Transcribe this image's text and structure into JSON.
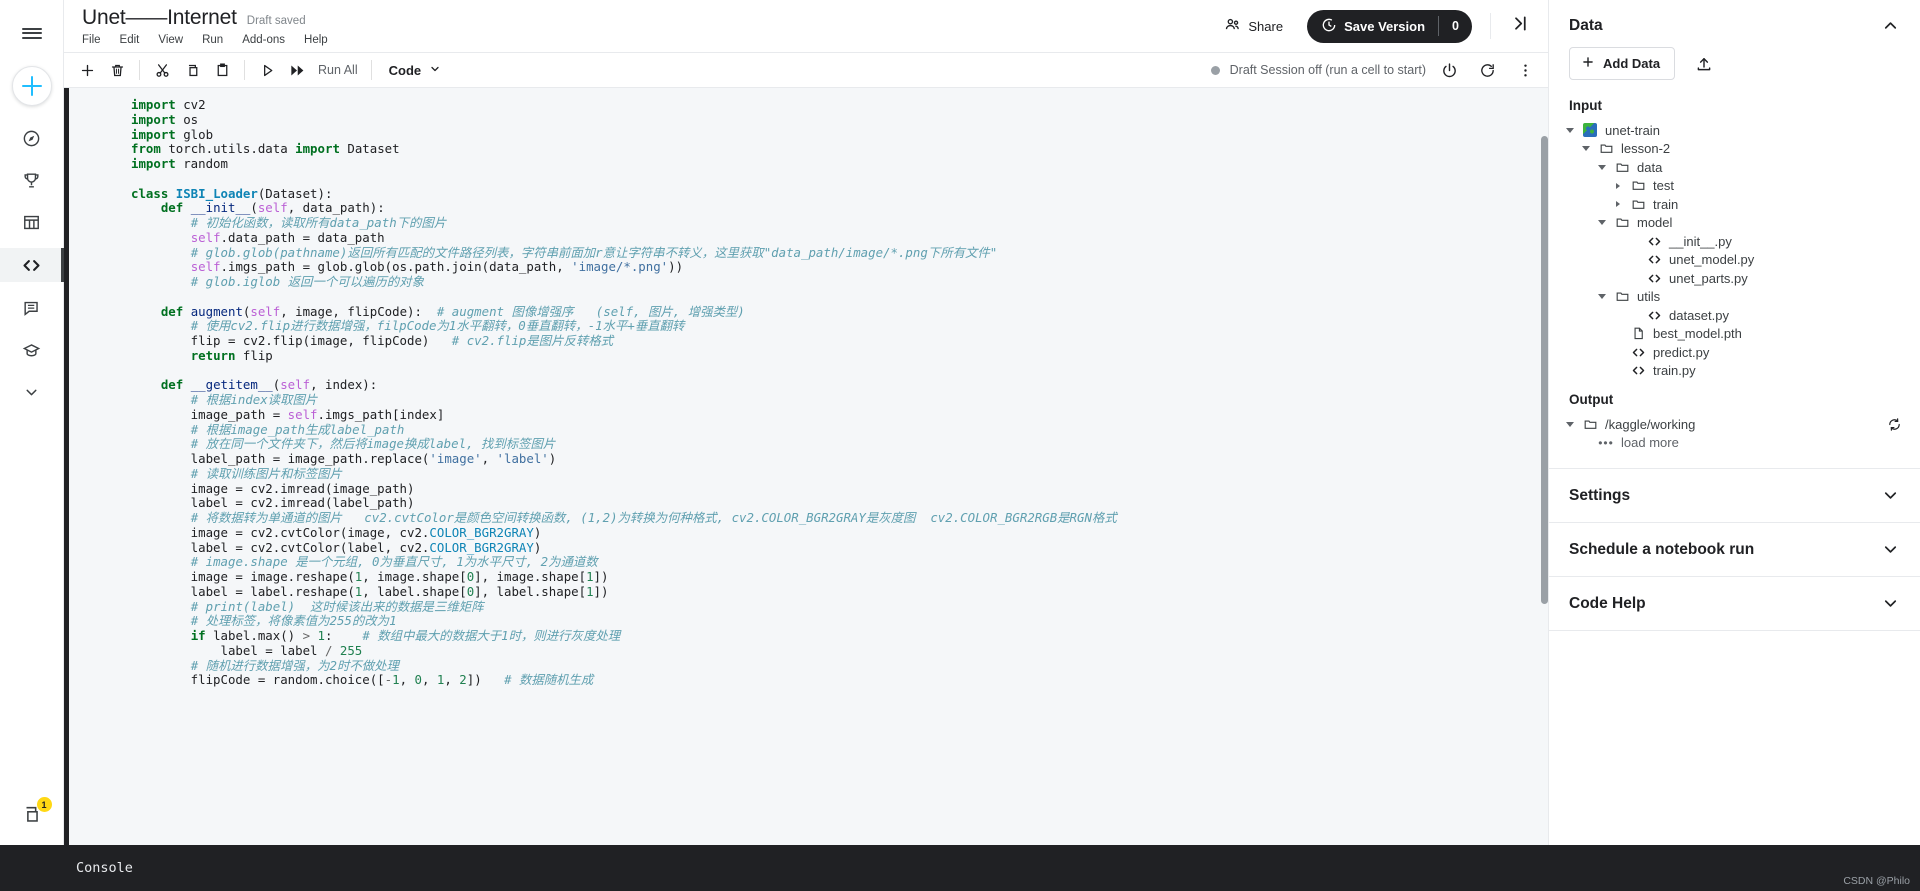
{
  "rail": {
    "hamburger": "menu-icon",
    "create_label": "create-new",
    "items": [
      {
        "name": "home-compass-icon"
      },
      {
        "name": "competitions-trophy-icon"
      },
      {
        "name": "datasets-table-icon"
      },
      {
        "name": "code-icon"
      },
      {
        "name": "discussions-icon"
      },
      {
        "name": "learn-graduation-icon"
      },
      {
        "name": "more-chevron-down-icon"
      }
    ],
    "bottom_badge": "1"
  },
  "header": {
    "title": "Unet——Internet",
    "draft_status": "Draft saved",
    "menu": [
      "File",
      "Edit",
      "View",
      "Run",
      "Add-ons",
      "Help"
    ],
    "share_label": "Share",
    "save_version_label": "Save Version",
    "save_version_count": "0"
  },
  "toolbar": {
    "icons": [
      "add-cell-icon",
      "delete-cell-icon",
      "cut-icon",
      "copy-icon",
      "paste-icon",
      "run-icon",
      "run-all-icon"
    ],
    "run_all_label": "Run All",
    "cell_type": "Code",
    "session_status": "Draft Session off (run a cell to start)",
    "power_icon": "power-icon",
    "restart_icon": "restart-icon",
    "more_icon": "more-vertical-icon"
  },
  "code": {
    "lines": [
      [
        [
          "kn",
          "import "
        ],
        [
          "p",
          "cv2"
        ]
      ],
      [
        [
          "kn",
          "import "
        ],
        [
          "p",
          "os"
        ]
      ],
      [
        [
          "kn",
          "import "
        ],
        [
          "p",
          "glob"
        ]
      ],
      [
        [
          "kn",
          "from "
        ],
        [
          "p",
          "torch.utils.data "
        ],
        [
          "kn",
          "import "
        ],
        [
          "p",
          "Dataset"
        ]
      ],
      [
        [
          "kn",
          "import "
        ],
        [
          "p",
          "random"
        ]
      ],
      [],
      [
        [
          "k",
          "class "
        ],
        [
          "cls",
          "ISBI_Loader"
        ],
        [
          "p",
          "(Dataset):"
        ]
      ],
      [
        [
          "p",
          "    "
        ],
        [
          "k",
          "def "
        ],
        [
          "fn",
          "__init__"
        ],
        [
          "p",
          "("
        ],
        [
          "se",
          "self"
        ],
        [
          "p",
          ", data_path):"
        ]
      ],
      [
        [
          "p",
          "        "
        ],
        [
          "cm",
          "# 初始化函数，读取所有data_path下的图片"
        ]
      ],
      [
        [
          "p",
          "        "
        ],
        [
          "se",
          "self"
        ],
        [
          "p",
          ".data_path = data_path"
        ]
      ],
      [
        [
          "p",
          "        "
        ],
        [
          "cm",
          "# glob.glob(pathname)返回所有匹配的文件路径列表，字符串前面加r意让字符串不转义，这里获取\"data_path/image/*.png下所有文件\""
        ]
      ],
      [
        [
          "p",
          "        "
        ],
        [
          "se",
          "self"
        ],
        [
          "p",
          ".imgs_path = glob.glob(os.path.join(data_path, "
        ],
        [
          "st",
          "'image/*.png'"
        ],
        [
          "p",
          "))"
        ]
      ],
      [
        [
          "p",
          "        "
        ],
        [
          "cm",
          "# glob.iglob 返回一个可以遍历的对象"
        ]
      ],
      [],
      [
        [
          "p",
          "    "
        ],
        [
          "k",
          "def "
        ],
        [
          "fn",
          "augment"
        ],
        [
          "p",
          "("
        ],
        [
          "se",
          "self"
        ],
        [
          "p",
          ", image, flipCode):  "
        ],
        [
          "cm",
          "# augment 图像增强序   (self, 图片, 增强类型)"
        ]
      ],
      [
        [
          "p",
          "        "
        ],
        [
          "cm",
          "# 使用cv2.flip进行数据增强，filpCode为1水平翻转，0垂直翻转，-1水平+垂直翻转"
        ]
      ],
      [
        [
          "p",
          "        flip = cv2.flip(image, flipCode)   "
        ],
        [
          "cm",
          "# cv2.flip是图片反转格式"
        ]
      ],
      [
        [
          "p",
          "        "
        ],
        [
          "k",
          "return "
        ],
        [
          "p",
          "flip"
        ]
      ],
      [],
      [
        [
          "p",
          "    "
        ],
        [
          "k",
          "def "
        ],
        [
          "fn",
          "__getitem__"
        ],
        [
          "p",
          "("
        ],
        [
          "se",
          "self"
        ],
        [
          "p",
          ", index):"
        ]
      ],
      [
        [
          "p",
          "        "
        ],
        [
          "cm",
          "# 根据index读取图片"
        ]
      ],
      [
        [
          "p",
          "        image_path = "
        ],
        [
          "se",
          "self"
        ],
        [
          "p",
          ".imgs_path[index]"
        ]
      ],
      [
        [
          "p",
          "        "
        ],
        [
          "cm",
          "# 根据image_path生成label_path"
        ]
      ],
      [
        [
          "p",
          "        "
        ],
        [
          "cm",
          "# 放在同一个文件夹下，然后将image换成label, 找到标签图片"
        ]
      ],
      [
        [
          "p",
          "        label_path = image_path.replace("
        ],
        [
          "st",
          "'image'"
        ],
        [
          "p",
          ", "
        ],
        [
          "st",
          "'label'"
        ],
        [
          "p",
          ")"
        ]
      ],
      [
        [
          "p",
          "        "
        ],
        [
          "cm",
          "# 读取训练图片和标签图片"
        ]
      ],
      [
        [
          "p",
          "        image = cv2.imread(image_path)"
        ]
      ],
      [
        [
          "p",
          "        label = cv2.imread(label_path)"
        ]
      ],
      [
        [
          "p",
          "        "
        ],
        [
          "cm",
          "# 将数据转为单通道的图片   cv2.cvtColor是颜色空间转换函数, (1,2)为转换为何种格式, cv2.COLOR_BGR2GRAY是灰度图  cv2.COLOR_BGR2RGB是RGN格式"
        ]
      ],
      [
        [
          "p",
          "        image = cv2.cvtColor(image, cv2."
        ],
        [
          "at",
          "COLOR_BGR2GRAY"
        ],
        [
          "p",
          ")"
        ]
      ],
      [
        [
          "p",
          "        label = cv2.cvtColor(label, cv2."
        ],
        [
          "at",
          "COLOR_BGR2GRAY"
        ],
        [
          "p",
          ")"
        ]
      ],
      [
        [
          "p",
          "        "
        ],
        [
          "cm",
          "# image.shape 是一个元组, 0为垂直尺寸, 1为水平尺寸, 2为通道数"
        ]
      ],
      [
        [
          "p",
          "        image = image.reshape("
        ],
        [
          "nu",
          "1"
        ],
        [
          "p",
          ", image.shape["
        ],
        [
          "nu",
          "0"
        ],
        [
          "p",
          "], image.shape["
        ],
        [
          "nu",
          "1"
        ],
        [
          "p",
          "])"
        ]
      ],
      [
        [
          "p",
          "        label = label.reshape("
        ],
        [
          "nu",
          "1"
        ],
        [
          "p",
          ", label.shape["
        ],
        [
          "nu",
          "0"
        ],
        [
          "p",
          "], label.shape["
        ],
        [
          "nu",
          "1"
        ],
        [
          "p",
          "])"
        ]
      ],
      [
        [
          "p",
          "        "
        ],
        [
          "cm",
          "# print(label)  这时候该出来的数据是三维矩阵"
        ]
      ],
      [
        [
          "p",
          "        "
        ],
        [
          "cm",
          "# 处理标签，将像素值为255的改为1"
        ]
      ],
      [
        [
          "p",
          "        "
        ],
        [
          "k",
          "if "
        ],
        [
          "p",
          "label.max() "
        ],
        [
          "op",
          "> "
        ],
        [
          "nu",
          "1"
        ],
        [
          "p",
          ":    "
        ],
        [
          "cm",
          "# 数组中最大的数据大于1时，则进行灰度处理"
        ]
      ],
      [
        [
          "p",
          "            label = label "
        ],
        [
          "op",
          "/ "
        ],
        [
          "nu",
          "255"
        ]
      ],
      [
        [
          "p",
          "        "
        ],
        [
          "cm",
          "# 随机进行数据增强，为2时不做处理"
        ]
      ],
      [
        [
          "p",
          "        flipCode = random.choice(["
        ],
        [
          "op",
          "-"
        ],
        [
          "nu",
          "1"
        ],
        [
          "p",
          ", "
        ],
        [
          "nu",
          "0"
        ],
        [
          "p",
          ", "
        ],
        [
          "nu",
          "1"
        ],
        [
          "p",
          ", "
        ],
        [
          "nu",
          "2"
        ],
        [
          "p",
          "])   "
        ],
        [
          "cm",
          "# 数据随机生成"
        ]
      ]
    ]
  },
  "data_panel": {
    "title": "Data",
    "add_data_label": "Add Data",
    "upload_icon": "upload-icon",
    "input_label": "Input",
    "output_label": "Output",
    "tree": [
      {
        "depth": 0,
        "caret": "open",
        "icon": "dataset",
        "label": "unet-train"
      },
      {
        "depth": 1,
        "caret": "open",
        "icon": "folder",
        "label": "lesson-2"
      },
      {
        "depth": 2,
        "caret": "open",
        "icon": "folder",
        "label": "data"
      },
      {
        "depth": 3,
        "caret": "closed",
        "icon": "folder",
        "label": "test"
      },
      {
        "depth": 3,
        "caret": "closed",
        "icon": "folder",
        "label": "train"
      },
      {
        "depth": 2,
        "caret": "open",
        "icon": "folder",
        "label": "model"
      },
      {
        "depth": 4,
        "caret": "none",
        "icon": "code",
        "label": "__init__.py"
      },
      {
        "depth": 4,
        "caret": "none",
        "icon": "code",
        "label": "unet_model.py"
      },
      {
        "depth": 4,
        "caret": "none",
        "icon": "code",
        "label": "unet_parts.py"
      },
      {
        "depth": 2,
        "caret": "open",
        "icon": "folder",
        "label": "utils"
      },
      {
        "depth": 4,
        "caret": "none",
        "icon": "code",
        "label": "dataset.py"
      },
      {
        "depth": 3,
        "caret": "none",
        "icon": "file",
        "label": "best_model.pth"
      },
      {
        "depth": 3,
        "caret": "none",
        "icon": "code",
        "label": "predict.py"
      },
      {
        "depth": 3,
        "caret": "none",
        "icon": "code",
        "label": "train.py"
      }
    ],
    "output_tree": [
      {
        "depth": 0,
        "caret": "open",
        "icon": "folder",
        "label": "/kaggle/working",
        "refresh": true
      },
      {
        "depth": 1,
        "caret": "none",
        "icon": "dots",
        "label": "load more"
      }
    ],
    "sections": [
      {
        "label": "Settings"
      },
      {
        "label": "Schedule a notebook run"
      },
      {
        "label": "Code Help"
      }
    ]
  },
  "console": {
    "label": "Console",
    "watermark": "CSDN @Philo"
  }
}
